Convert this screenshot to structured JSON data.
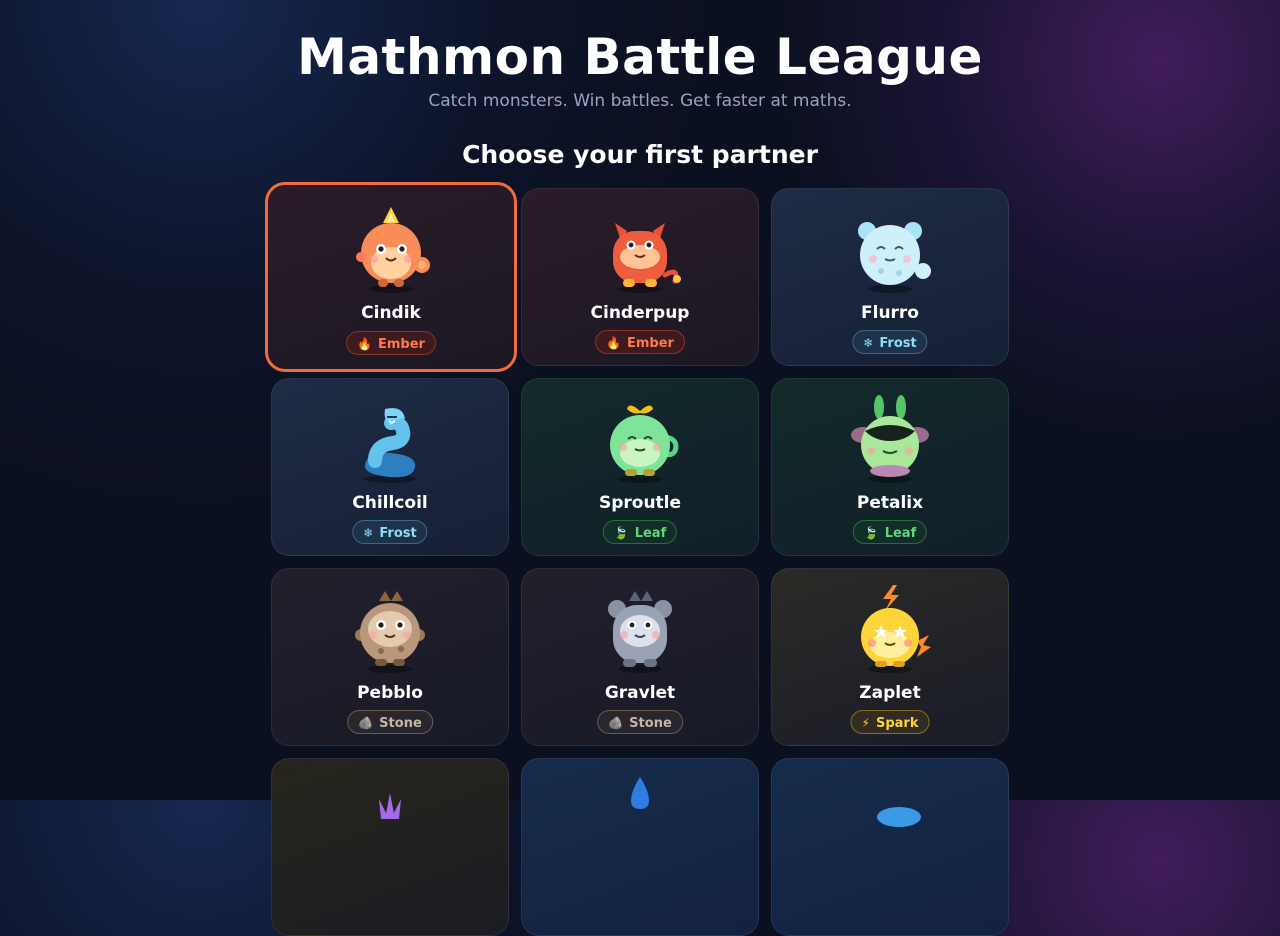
{
  "header": {
    "title": "Mathmon Battle League",
    "subtitle": "Catch monsters. Win battles. Get faster at maths.",
    "prompt": "Choose your first partner"
  },
  "monsters": [
    {
      "name": "Cindik",
      "type": "Ember",
      "type_icon": "fire-icon",
      "selected": true
    },
    {
      "name": "Cinderpup",
      "type": "Ember",
      "type_icon": "fire-icon",
      "selected": false
    },
    {
      "name": "Flurro",
      "type": "Frost",
      "type_icon": "snowflake-icon",
      "selected": false
    },
    {
      "name": "Chillcoil",
      "type": "Frost",
      "type_icon": "snowflake-icon",
      "selected": false
    },
    {
      "name": "Sproutle",
      "type": "Leaf",
      "type_icon": "leaf-icon",
      "selected": false
    },
    {
      "name": "Petalix",
      "type": "Leaf",
      "type_icon": "leaf-icon",
      "selected": false
    },
    {
      "name": "Pebblo",
      "type": "Stone",
      "type_icon": "rock-icon",
      "selected": false
    },
    {
      "name": "Gravlet",
      "type": "Stone",
      "type_icon": "rock-icon",
      "selected": false
    },
    {
      "name": "Zaplet",
      "type": "Spark",
      "type_icon": "lightning-icon",
      "selected": false
    }
  ],
  "type_glyphs": {
    "Ember": "🔥",
    "Frost": "❄",
    "Leaf": "🍃",
    "Stone": "🪨",
    "Spark": "⚡"
  },
  "colors": {
    "ember": "#ff7a4d",
    "frost": "#8fdcf5",
    "leaf": "#5ed778",
    "stone": "#c6b6a8",
    "spark": "#ffd23d",
    "selected_border": "#f26b3a"
  }
}
